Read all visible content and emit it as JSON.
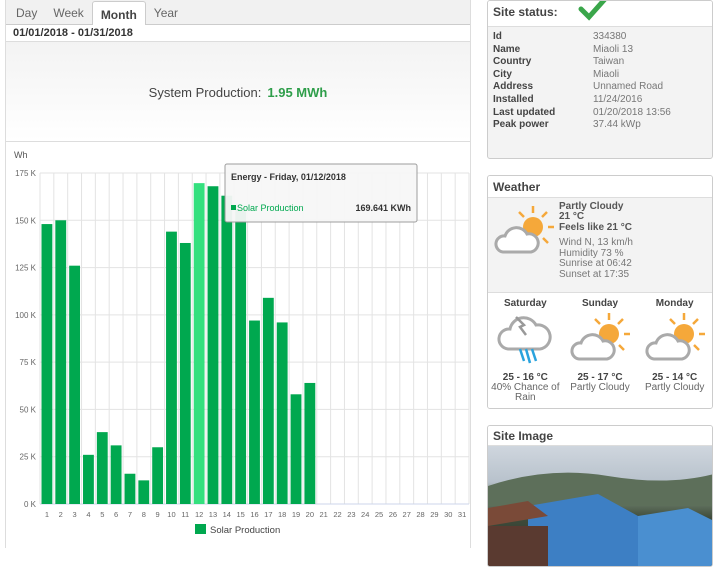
{
  "tabs": [
    {
      "label": "Day"
    },
    {
      "label": "Week"
    },
    {
      "label": "Month",
      "active": true
    },
    {
      "label": "Year"
    }
  ],
  "date_range": "01/01/2018 - 01/31/2018",
  "summary": {
    "label": "System Production:",
    "value": "1.95 MWh"
  },
  "chart_data": {
    "type": "bar",
    "ylabel": "Wh",
    "ylim": [
      0,
      175000
    ],
    "yticks": [
      "0 K",
      "25 K",
      "50 K",
      "75 K",
      "100 K",
      "125 K",
      "150 K",
      "175 K"
    ],
    "categories": [
      "1",
      "2",
      "3",
      "4",
      "5",
      "6",
      "7",
      "8",
      "9",
      "10",
      "11",
      "12",
      "13",
      "14",
      "15",
      "16",
      "17",
      "18",
      "19",
      "20",
      "21",
      "22",
      "23",
      "24",
      "25",
      "26",
      "27",
      "28",
      "29",
      "30",
      "31"
    ],
    "series": [
      {
        "name": "Solar Production",
        "color": "#00a84f",
        "values": [
          148000,
          150000,
          126000,
          26000,
          38000,
          31000,
          16000,
          12500,
          30000,
          144000,
          138000,
          169641,
          168000,
          163000,
          156000,
          97000,
          109000,
          96000,
          58000,
          64000,
          null,
          null,
          null,
          null,
          null,
          null,
          null,
          null,
          null,
          null,
          null
        ]
      }
    ],
    "highlight_color": "#34e07e",
    "grid": true,
    "legend": "bottom",
    "tooltip": {
      "title": "Energy - Friday, 01/12/2018",
      "series": "Solar Production",
      "value": "169.641 KWh",
      "index": 11
    }
  },
  "site": {
    "status_label": "Site status:",
    "status_icon": "check-icon",
    "status_color": "#3aa64a",
    "fields": [
      {
        "k": "Id",
        "v": "334380"
      },
      {
        "k": "Name",
        "v": "Miaoli 13"
      },
      {
        "k": "Country",
        "v": "Taiwan"
      },
      {
        "k": "City",
        "v": "Miaoli"
      },
      {
        "k": "Address",
        "v": "Unnamed Road"
      },
      {
        "k": "Installed",
        "v": "11/24/2016"
      },
      {
        "k": "Last updated",
        "v": "01/20/2018 13:56"
      },
      {
        "k": "Peak power",
        "v": "37.44 kWp"
      }
    ]
  },
  "weather": {
    "title": "Weather",
    "now": {
      "cond": "Partly Cloudy",
      "temp": "21 °C",
      "feels": "Feels like 21 °C",
      "wind": "Wind N, 13 km/h",
      "humidity": "Humidity 73 %",
      "sunrise": "Sunrise at 06:42",
      "sunset": "Sunset at 17:35",
      "icon": "partly-cloudy-icon"
    },
    "forecast": [
      {
        "day": "Saturday",
        "temp": "25 - 16 °C",
        "cond": "40% Chance of Rain",
        "icon": "thunderstorm-rain-icon"
      },
      {
        "day": "Sunday",
        "temp": "25 - 17 °C",
        "cond": "Partly Cloudy",
        "icon": "partly-cloudy-icon"
      },
      {
        "day": "Monday",
        "temp": "25 - 14 °C",
        "cond": "Partly Cloudy",
        "icon": "partly-cloudy-icon"
      }
    ]
  },
  "site_image": {
    "title": "Site Image"
  }
}
